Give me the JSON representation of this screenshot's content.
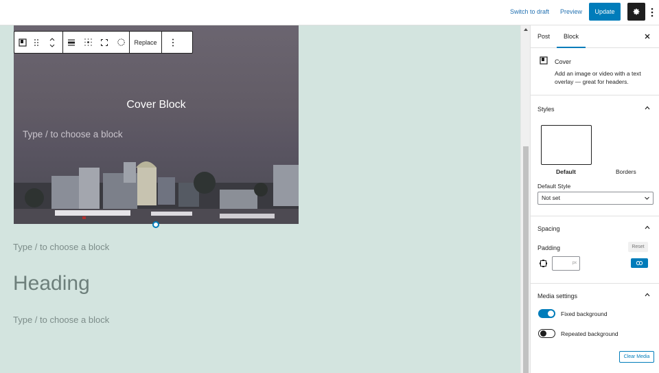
{
  "topbar": {
    "switch_to_draft": "Switch to draft",
    "preview": "Preview",
    "update": "Update"
  },
  "toolbar": {
    "replace": "Replace"
  },
  "canvas": {
    "cover_title": "Cover Block",
    "cover_placeholder": "Type / to choose a block",
    "placeholder_1": "Type / to choose a block",
    "heading": "Heading",
    "placeholder_2": "Type / to choose a block",
    "background": "#d3e4df"
  },
  "sidebar": {
    "tabs": {
      "post": "Post",
      "block": "Block"
    },
    "block": {
      "name": "Cover",
      "description": "Add an image or video with a text overlay — great for headers."
    },
    "styles": {
      "title": "Styles",
      "options": [
        "Default",
        "Borders"
      ],
      "selected": "Default",
      "default_style_label": "Default Style",
      "default_style_value": "Not set"
    },
    "spacing": {
      "title": "Spacing",
      "padding_label": "Padding",
      "reset": "Reset",
      "padding_unit": "px"
    },
    "media": {
      "title": "Media settings",
      "fixed_background": "Fixed background",
      "fixed_background_on": true,
      "repeated_background": "Repeated background",
      "repeated_background_on": false,
      "clear_media": "Clear Media"
    }
  },
  "colors": {
    "accent": "#007cba",
    "dark": "#1e1e1e"
  }
}
